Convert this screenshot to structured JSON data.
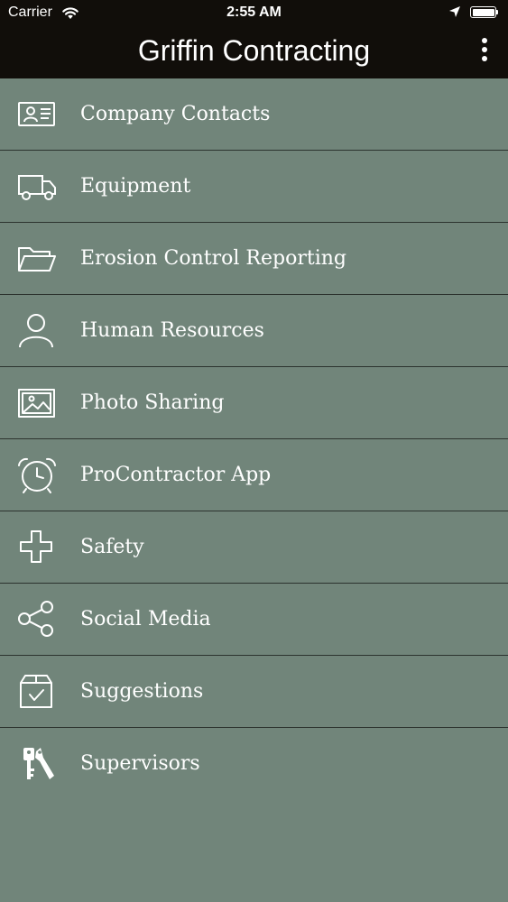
{
  "status_bar": {
    "carrier": "Carrier",
    "time": "2:55 AM",
    "wifi_icon": "wifi-icon",
    "location_icon": "location-arrow-icon",
    "battery_icon": "battery-icon"
  },
  "header": {
    "title": "Griffin Contracting",
    "menu_icon": "more-vertical-icon",
    "background": "#110e0a"
  },
  "colors": {
    "list_background": "#71857a",
    "divider": "#2c332e",
    "text": "#ffffff"
  },
  "menu": {
    "items": [
      {
        "label": "Company Contacts",
        "icon": "contact-card-icon"
      },
      {
        "label": "Equipment",
        "icon": "truck-icon"
      },
      {
        "label": "Erosion Control Reporting",
        "icon": "folder-icon"
      },
      {
        "label": "Human Resources",
        "icon": "person-icon"
      },
      {
        "label": "Photo Sharing",
        "icon": "image-icon"
      },
      {
        "label": "ProContractor App",
        "icon": "alarm-clock-icon"
      },
      {
        "label": "Safety",
        "icon": "plus-cross-icon"
      },
      {
        "label": "Social Media",
        "icon": "share-icon"
      },
      {
        "label": "Suggestions",
        "icon": "checked-box-icon"
      },
      {
        "label": "Supervisors",
        "icon": "keys-icon"
      }
    ]
  }
}
